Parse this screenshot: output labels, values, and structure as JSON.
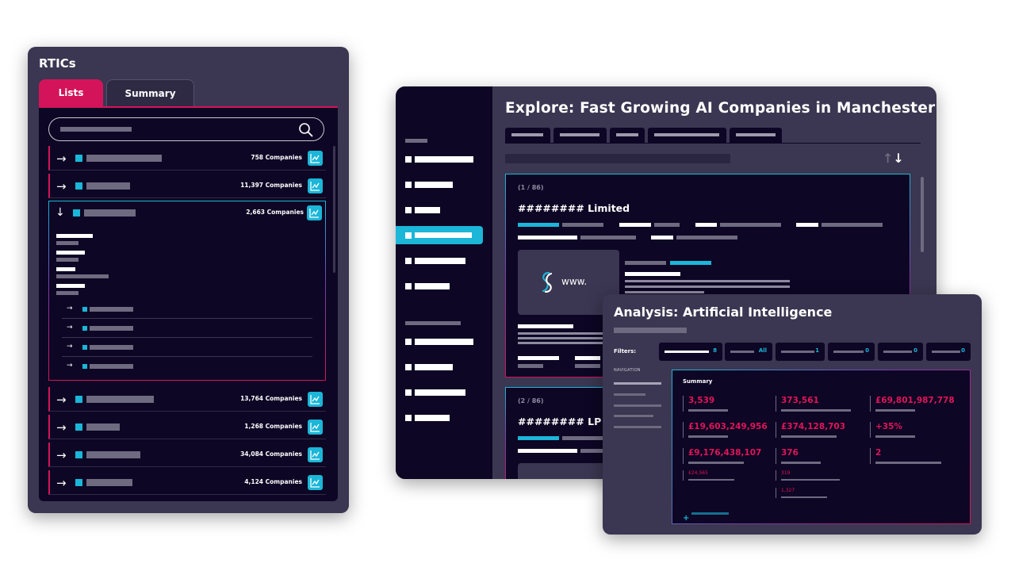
{
  "rtics": {
    "title": "RTICs",
    "tabs": {
      "lists": "Lists",
      "summary": "Summary"
    },
    "rows_top": [
      {
        "count": "758 Companies"
      },
      {
        "count": "11,397 Companies"
      }
    ],
    "expanded": {
      "count": "2,663 Companies"
    },
    "rows_bottom": [
      {
        "count": "13,764 Companies"
      },
      {
        "count": "1,268 Companies"
      },
      {
        "count": "34,084 Companies"
      },
      {
        "count": "4,124 Companies"
      }
    ]
  },
  "explore": {
    "title": "Explore: Fast Growing AI Companies in Manchester",
    "card1": {
      "index": "(1 / 86)",
      "name": "######## Limited",
      "logo_text": "www."
    },
    "card2": {
      "index": "(2 / 86)",
      "name": "######## LP"
    }
  },
  "analysis": {
    "title": "Analysis: Artificial Intelligence",
    "filters_label": "Filters:",
    "filters": [
      "8",
      "All",
      "1",
      "0",
      "0",
      "0"
    ],
    "nav_label": "NAVIGATION",
    "summary_title": "Summary",
    "stats": [
      "3,539",
      "373,561",
      "£69,801,987,778",
      "£19,603,249,956",
      "£374,128,703",
      "+35%",
      "£9,176,438,107",
      "376",
      "2"
    ],
    "minis": [
      "£24,565",
      "319",
      "1,327"
    ],
    "add_symbol": "+"
  },
  "colors": {
    "accent_pink": "#d4145a",
    "accent_cyan": "#1bb6d8",
    "panel_bg": "#3b3651",
    "dark_bg": "#0d0624"
  }
}
